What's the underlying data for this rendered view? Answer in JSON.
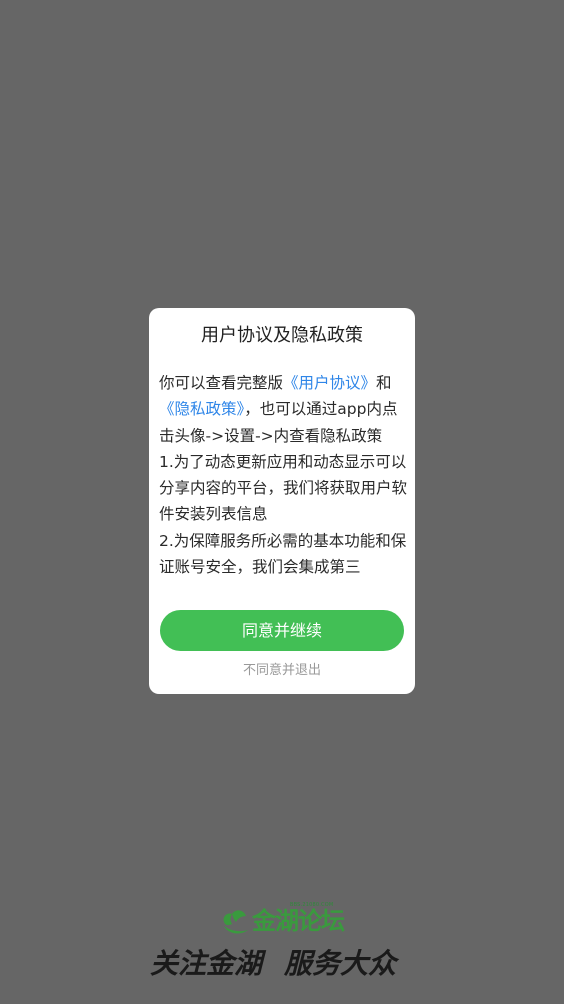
{
  "dialog": {
    "title": "用户协议及隐私政策",
    "body": {
      "intro_prefix": "你可以查看完整版",
      "user_agreement_link": "《用户协议》",
      "and_text": "和",
      "privacy_policy_link": "《隐私政策》",
      "intro_suffix": "，也可以通过app内点击头像->设置->内查看隐私政策",
      "item_1": "1.为了动态更新应用和动态显示可以分享内容的平台，我们将获取用户软件安装列表信息",
      "item_2": "2.为保障服务所必需的基本功能和保证账号安全，我们会集成第三"
    },
    "agree_button_label": "同意并继续",
    "decline_label": "不同意并退出"
  },
  "branding": {
    "logo_url_text": "BBS.21080.COM",
    "logo_text": "金湖论坛",
    "slogan_part1": "关注金湖",
    "slogan_part2": "服务大众"
  },
  "colors": {
    "overlay": "#666666",
    "accent_green": "#42bf55",
    "link_blue": "#2f86e8",
    "logo_green": "#3a9a3e"
  }
}
